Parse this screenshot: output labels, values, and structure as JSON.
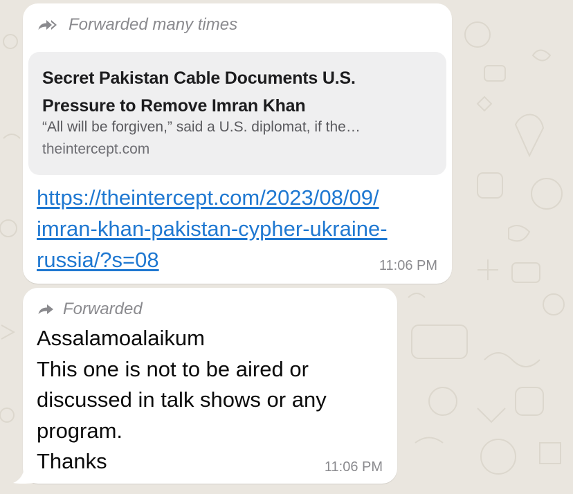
{
  "message1": {
    "forwarded_label": "Forwarded many times",
    "preview": {
      "title": "Secret Pakistan Cable Documents U.S. Pressure to Remove Imran Khan",
      "description": "“All will be forgiven,” said a U.S. diplomat, if the…",
      "domain": "theintercept.com"
    },
    "link_lines": [
      "https://theintercept.com/2023/08/09/",
      "imran-khan-pakistan-cypher-ukraine-",
      "russia/?s=08"
    ],
    "time": "11:06 PM"
  },
  "message2": {
    "forwarded_label": "Forwarded",
    "lines": [
      "Assalamoalaikum",
      "This one is not to be aired or",
      "discussed in talk shows or any",
      "program.",
      "Thanks"
    ],
    "time": "11:06 PM"
  },
  "colors": {
    "background": "#eae6df",
    "bubble": "#ffffff",
    "link": "#1f78d1",
    "meta_gray": "#8a8a8e"
  },
  "icons": {
    "forwarded_many": "double-forward-arrow-icon",
    "forwarded": "forward-arrow-icon"
  }
}
